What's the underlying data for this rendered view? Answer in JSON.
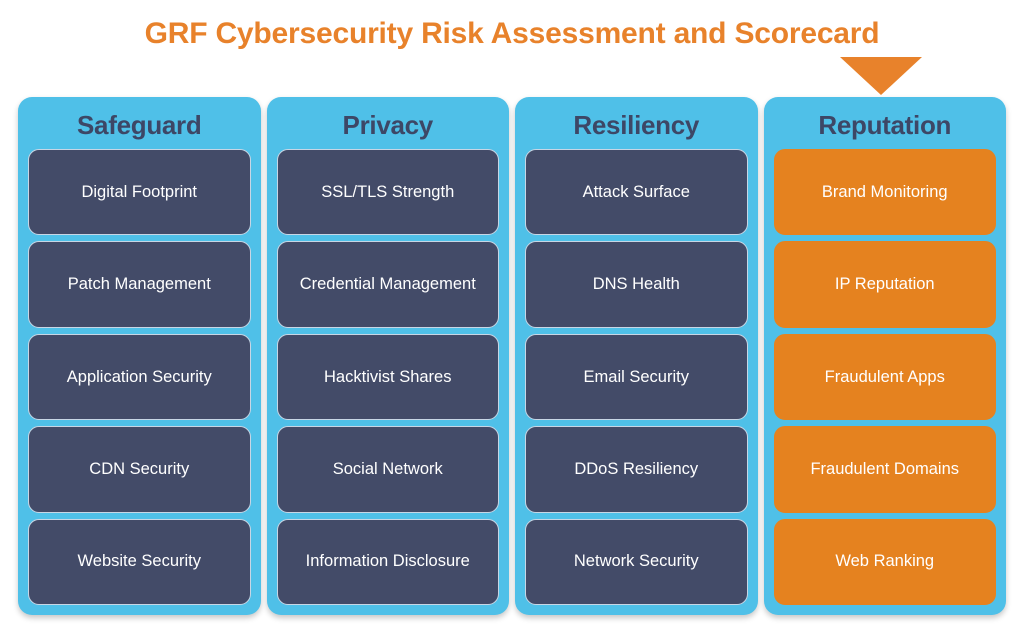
{
  "page": {
    "title": "GRF Cybersecurity Risk Assessment and Scorecard",
    "background_color": "#FFFFFF"
  },
  "colors": {
    "title_orange": "#E8822B",
    "column_blue": "#4FC0E8",
    "header_navy": "#3D4766",
    "card_navy": "#434B68",
    "card_orange": "#E5821F",
    "card_text": "#FFFFFF",
    "card_border": "#C8D6E5"
  },
  "pointer": {
    "icon": "triangle-down-icon",
    "points_to": "Reputation",
    "color": "#E8822B"
  },
  "columns": [
    {
      "header": "Safeguard",
      "highlighted": false,
      "cards": [
        {
          "label": "Digital Footprint",
          "style": "navy"
        },
        {
          "label": "Patch Management",
          "style": "navy"
        },
        {
          "label": "Application Security",
          "style": "navy"
        },
        {
          "label": "CDN Security",
          "style": "navy"
        },
        {
          "label": "Website Security",
          "style": "navy"
        }
      ]
    },
    {
      "header": "Privacy",
      "highlighted": false,
      "cards": [
        {
          "label": "SSL/TLS Strength",
          "style": "navy"
        },
        {
          "label": "Credential Management",
          "style": "navy"
        },
        {
          "label": "Hacktivist Shares",
          "style": "navy"
        },
        {
          "label": "Social Network",
          "style": "navy"
        },
        {
          "label": "Information Disclosure",
          "style": "navy"
        }
      ]
    },
    {
      "header": "Resiliency",
      "highlighted": false,
      "cards": [
        {
          "label": "Attack Surface",
          "style": "navy"
        },
        {
          "label": "DNS Health",
          "style": "navy"
        },
        {
          "label": "Email Security",
          "style": "navy"
        },
        {
          "label": "DDoS Resiliency",
          "style": "navy"
        },
        {
          "label": "Network Security",
          "style": "navy"
        }
      ]
    },
    {
      "header": "Reputation",
      "highlighted": true,
      "cards": [
        {
          "label": "Brand Monitoring",
          "style": "orange"
        },
        {
          "label": "IP Reputation",
          "style": "orange"
        },
        {
          "label": "Fraudulent Apps",
          "style": "orange"
        },
        {
          "label": "Fraudulent Domains",
          "style": "orange"
        },
        {
          "label": "Web Ranking",
          "style": "orange"
        }
      ]
    }
  ]
}
